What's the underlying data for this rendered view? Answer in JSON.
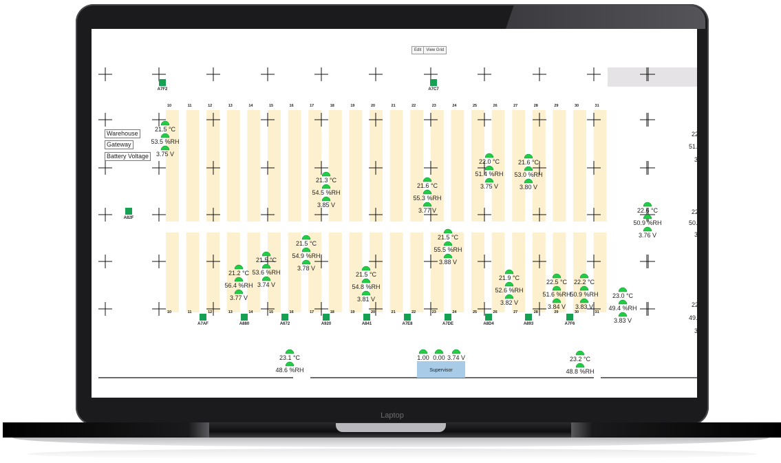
{
  "brand_label": "Laptop",
  "toolbar": {
    "edit_label": "Edit",
    "view_grid_label": "View Grid"
  },
  "legend": {
    "warehouse": "Warehouse",
    "gateway": "Gateway",
    "battery": "Battery Voltage"
  },
  "colors": {
    "aisle": "#fdf0cf",
    "gateway": "#16a051",
    "sensor": "#22cc44",
    "supervisor": "#a8cce8",
    "highlight": "#e5e3e5"
  },
  "aisle_numbers": [
    "10",
    "11",
    "12",
    "13",
    "14",
    "15",
    "16",
    "17",
    "18",
    "19",
    "20",
    "21",
    "22",
    "23",
    "24",
    "25",
    "26",
    "27",
    "28",
    "29",
    "30",
    "31"
  ],
  "supervisor": {
    "label": "Supervisor",
    "values": [
      "1.00",
      "0.00",
      "3.74 V"
    ]
  },
  "gateways": [
    {
      "label": "A7F2"
    },
    {
      "label": "A7C7"
    },
    {
      "label": "A82F"
    },
    {
      "label": "A7AF"
    },
    {
      "label": "A880"
    },
    {
      "label": "A672"
    },
    {
      "label": "A920"
    },
    {
      "label": "A841"
    },
    {
      "label": "A7E8"
    },
    {
      "label": "A7DE"
    },
    {
      "label": "A8D4"
    },
    {
      "label": "A893"
    },
    {
      "label": "A7F6"
    }
  ],
  "sensors": [
    {
      "temp": "21.5 °C",
      "rh": "53.5 %RH",
      "v": "3.75 V"
    },
    {
      "temp": "21.3 °C",
      "rh": "54.5 %RH",
      "v": "3.85 V"
    },
    {
      "temp": "21.6 °C",
      "rh": "55.3 %RH",
      "v": "3.77 V"
    },
    {
      "temp": "22.0 °C",
      "rh": "51.4 %RH",
      "v": "3.75 V"
    },
    {
      "temp": "21.6 °C",
      "rh": "53.0 %RH",
      "v": "3.80 V"
    },
    {
      "temp": "22.6 °C",
      "rh": "50.9 %RH",
      "v": "3.76 V"
    },
    {
      "temp": "21.5 °C",
      "rh": "54.9 %RH",
      "v": "3.78 V"
    },
    {
      "temp": "21.5 °C",
      "rh": "55.5 %RH",
      "v": "3.88 V"
    },
    {
      "temp": "21.5 °C",
      "rh": "53.6 %RH",
      "v": "3.74 V"
    },
    {
      "temp": "21.2 °C",
      "rh": "56.4 %RH",
      "v": "3.77 V"
    },
    {
      "temp": "21.5 °C",
      "rh": "54.8 %RH",
      "v": "3.81 V"
    },
    {
      "temp": "21.9 °C",
      "rh": "52.6 %RH",
      "v": "3.82 V"
    },
    {
      "temp": "22.5 °C",
      "rh": "51.6 %RH",
      "v": "3.84 V"
    },
    {
      "temp": "22.2 °C",
      "rh": "50.9 %RH",
      "v": "3.83 V"
    },
    {
      "temp": "23.0 °C",
      "rh": "49.4 %RH",
      "v": "3.83 V"
    },
    {
      "temp": "23.1 °C",
      "rh": "48.6 %RH"
    },
    {
      "temp": "23.2 °C",
      "rh": "48.8 %RH"
    }
  ],
  "edge_values": [
    "22",
    "51.",
    "3",
    "22",
    "50.",
    "3",
    "22",
    "49.",
    "3"
  ]
}
